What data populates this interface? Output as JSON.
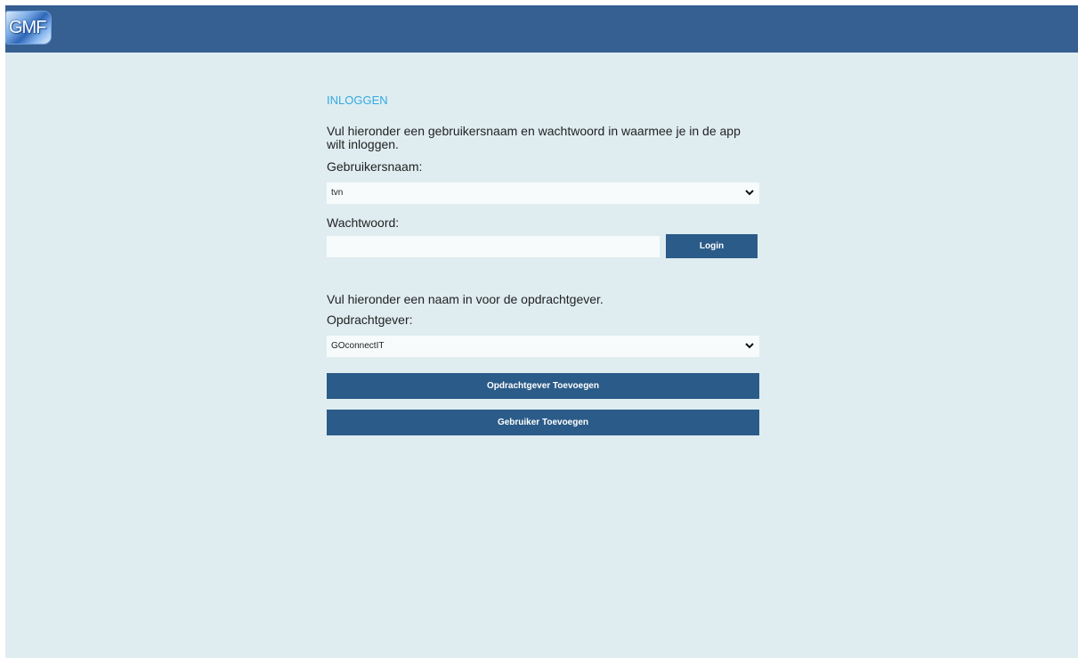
{
  "header": {
    "logo_text": "GMF"
  },
  "login": {
    "title": "INLOGGEN",
    "intro": "Vul hieronder een gebruikersnaam en wachtwoord in waarmee je in de app wilt inloggen.",
    "username_label": "Gebruikersnaam:",
    "username_value": "tvn",
    "password_label": "Wachtwoord:",
    "password_value": "",
    "login_button": "Login"
  },
  "client": {
    "intro": "Vul hieronder een naam in voor de opdrachtgever.",
    "label": "Opdrachtgever:",
    "value": "GOconnectIT",
    "add_client_button": "Opdrachtgever Toevoegen",
    "add_user_button": "Gebruiker Toevoegen"
  },
  "colors": {
    "header": "#365f92",
    "background": "#dfedf1",
    "accent_title": "#33aadd",
    "button": "#2b5b88"
  }
}
